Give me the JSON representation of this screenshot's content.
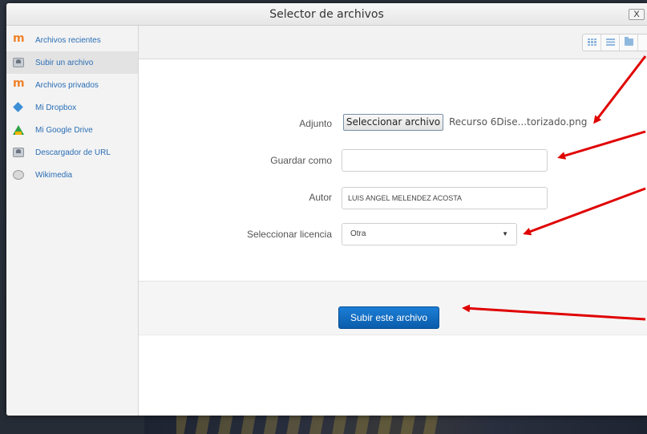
{
  "dialog": {
    "title": "Selector de archivos",
    "close_label": "X"
  },
  "sidebar": {
    "items": [
      {
        "label": "Archivos recientes",
        "icon": "moodle-icon"
      },
      {
        "label": "Subir un archivo",
        "icon": "upload-icon",
        "active": true
      },
      {
        "label": "Archivos privados",
        "icon": "moodle-icon"
      },
      {
        "label": "Mi Dropbox",
        "icon": "dropbox-icon"
      },
      {
        "label": "Mi Google Drive",
        "icon": "google-drive-icon"
      },
      {
        "label": "Descargador de URL",
        "icon": "url-downloader-icon"
      },
      {
        "label": "Wikimedia",
        "icon": "wikimedia-icon"
      }
    ]
  },
  "toolbar": {
    "views": [
      "grid-view-icon",
      "list-view-icon",
      "folder-view-icon"
    ]
  },
  "form": {
    "attachment_label": "Adjunto",
    "choose_file_label": "Seleccionar archivo",
    "chosen_file_name": "Recurso 6Dise...torizado.png",
    "save_as_label": "Guardar como",
    "save_as_value": "",
    "author_label": "Autor",
    "author_value": "LUIS ANGEL MELENDEZ ACOSTA",
    "license_label": "Seleccionar licencia",
    "license_value": "Otra",
    "submit_label": "Subir este archivo"
  },
  "colors": {
    "link": "#2a6eb5",
    "primary_button": "#0f6cc2",
    "annotation_arrow": "#e00000"
  }
}
